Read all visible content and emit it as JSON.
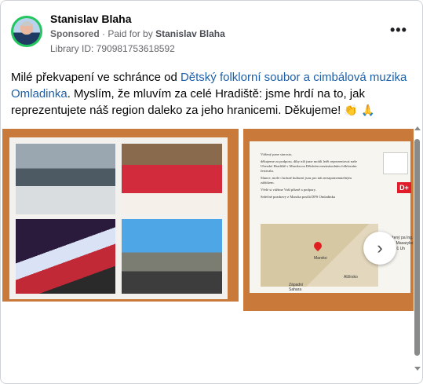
{
  "header": {
    "name": "Stanislav Blaha",
    "sponsored": "Sponsored",
    "separator": "·",
    "paid_prefix": "Paid for by",
    "paid_by": "Stanislav Blaha",
    "library_id": "Library ID: 790981753618592",
    "more_icon": "more-dots-icon"
  },
  "post": {
    "text_1": "Milé překvapení ve schránce od ",
    "link": "Dětský folklorní soubor a cimbálová muzika Omladinka",
    "text_2": ". Myslím, že mluvím za celé Hradiště: jsme hrdí na to, jak reprezentujete náš region daleko za jeho hranicemi. Děkujeme!",
    "emoji_1": "👏",
    "emoji_2": "🙏"
  },
  "postcard": {
    "line1": "Vážený pane starosto,",
    "line2": "děkujeme za podporu, díky níž jsme mohli letět reprezentovat naše Uherské Hradiště v Maroku na Dětském mezinárodním folklorním festivalu.",
    "line3": "Slunce, moře i krásné kulturní jsou pro nás nezapomenutelným zážitkem.",
    "line4": "Vřelé si vážíme Vaší přízně a podpory.",
    "line5": "Srdečné pozdravy z Maroka posílá DFS Omladinka",
    "map_label_1": "Maroko",
    "map_label_2": "Alžírsko",
    "map_label_3": "Západní Sahara",
    "stamp": "D+",
    "addr": "Vážený pa Ing. Stan Masaryko 686 01 Uh"
  },
  "carousel": {
    "next_icon": "chevron-right-icon",
    "next_glyph": "›"
  }
}
